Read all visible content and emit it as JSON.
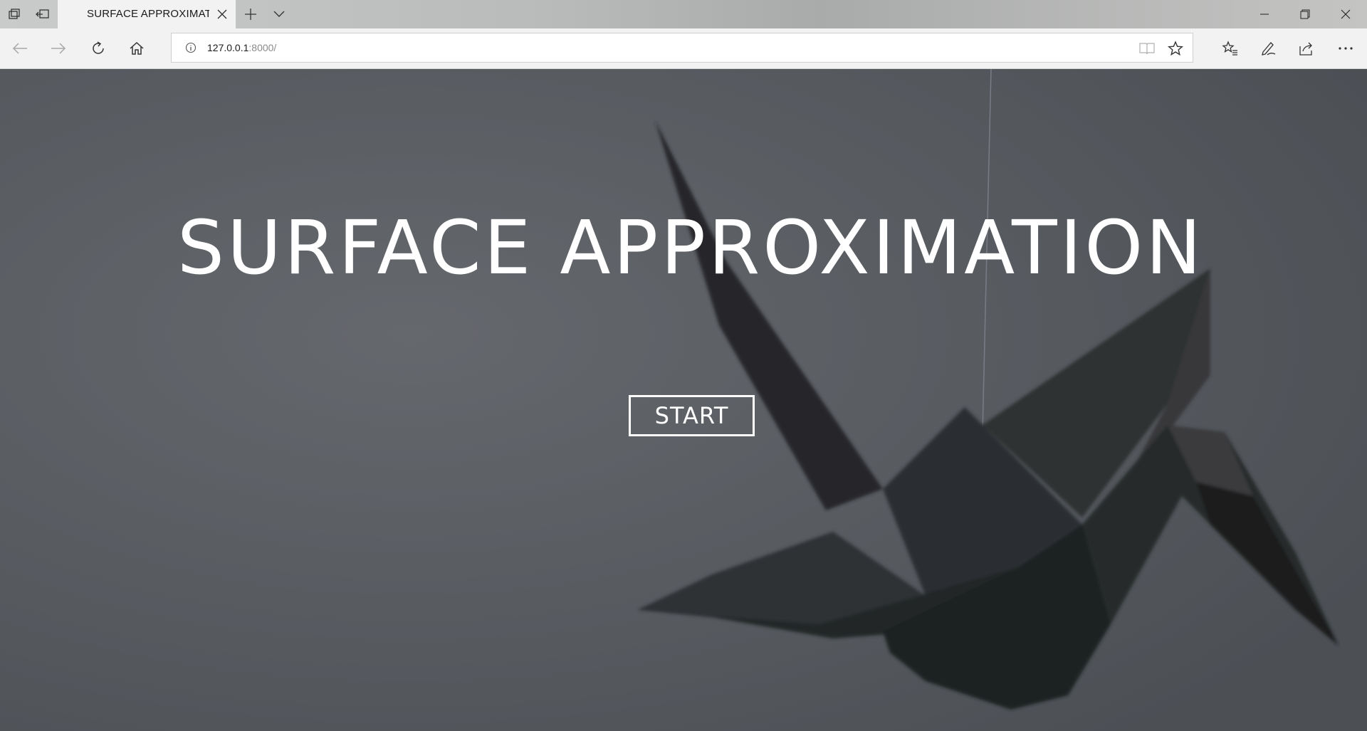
{
  "browser": {
    "tab": {
      "title": "SURFACE APPROXIMATI"
    },
    "address": {
      "host": "127.0.0.1",
      "port_path": ":8000/"
    },
    "icons": {
      "tab_actions": "tab-actions-icon",
      "set_aside": "set-aside-tabs-icon",
      "close_tab": "close-icon",
      "new_tab": "plus-icon",
      "tab_menu": "chevron-down-icon",
      "minimize": "minimize-icon",
      "restore": "restore-icon",
      "close_window": "close-icon",
      "back": "back-arrow-icon",
      "forward": "forward-arrow-icon",
      "refresh": "refresh-icon",
      "home": "home-icon",
      "info": "info-icon",
      "reading_view": "reading-view-icon",
      "favorite": "star-icon",
      "favorites_hub": "favorites-list-icon",
      "notes": "pen-icon",
      "share": "share-icon",
      "more": "more-icon"
    }
  },
  "page": {
    "title": "SURFACE APPROXIMATION",
    "start_label": "START"
  },
  "colors": {
    "page_background": "#5b5f64",
    "crane": "#2a2c2e",
    "text": "#ffffff"
  }
}
